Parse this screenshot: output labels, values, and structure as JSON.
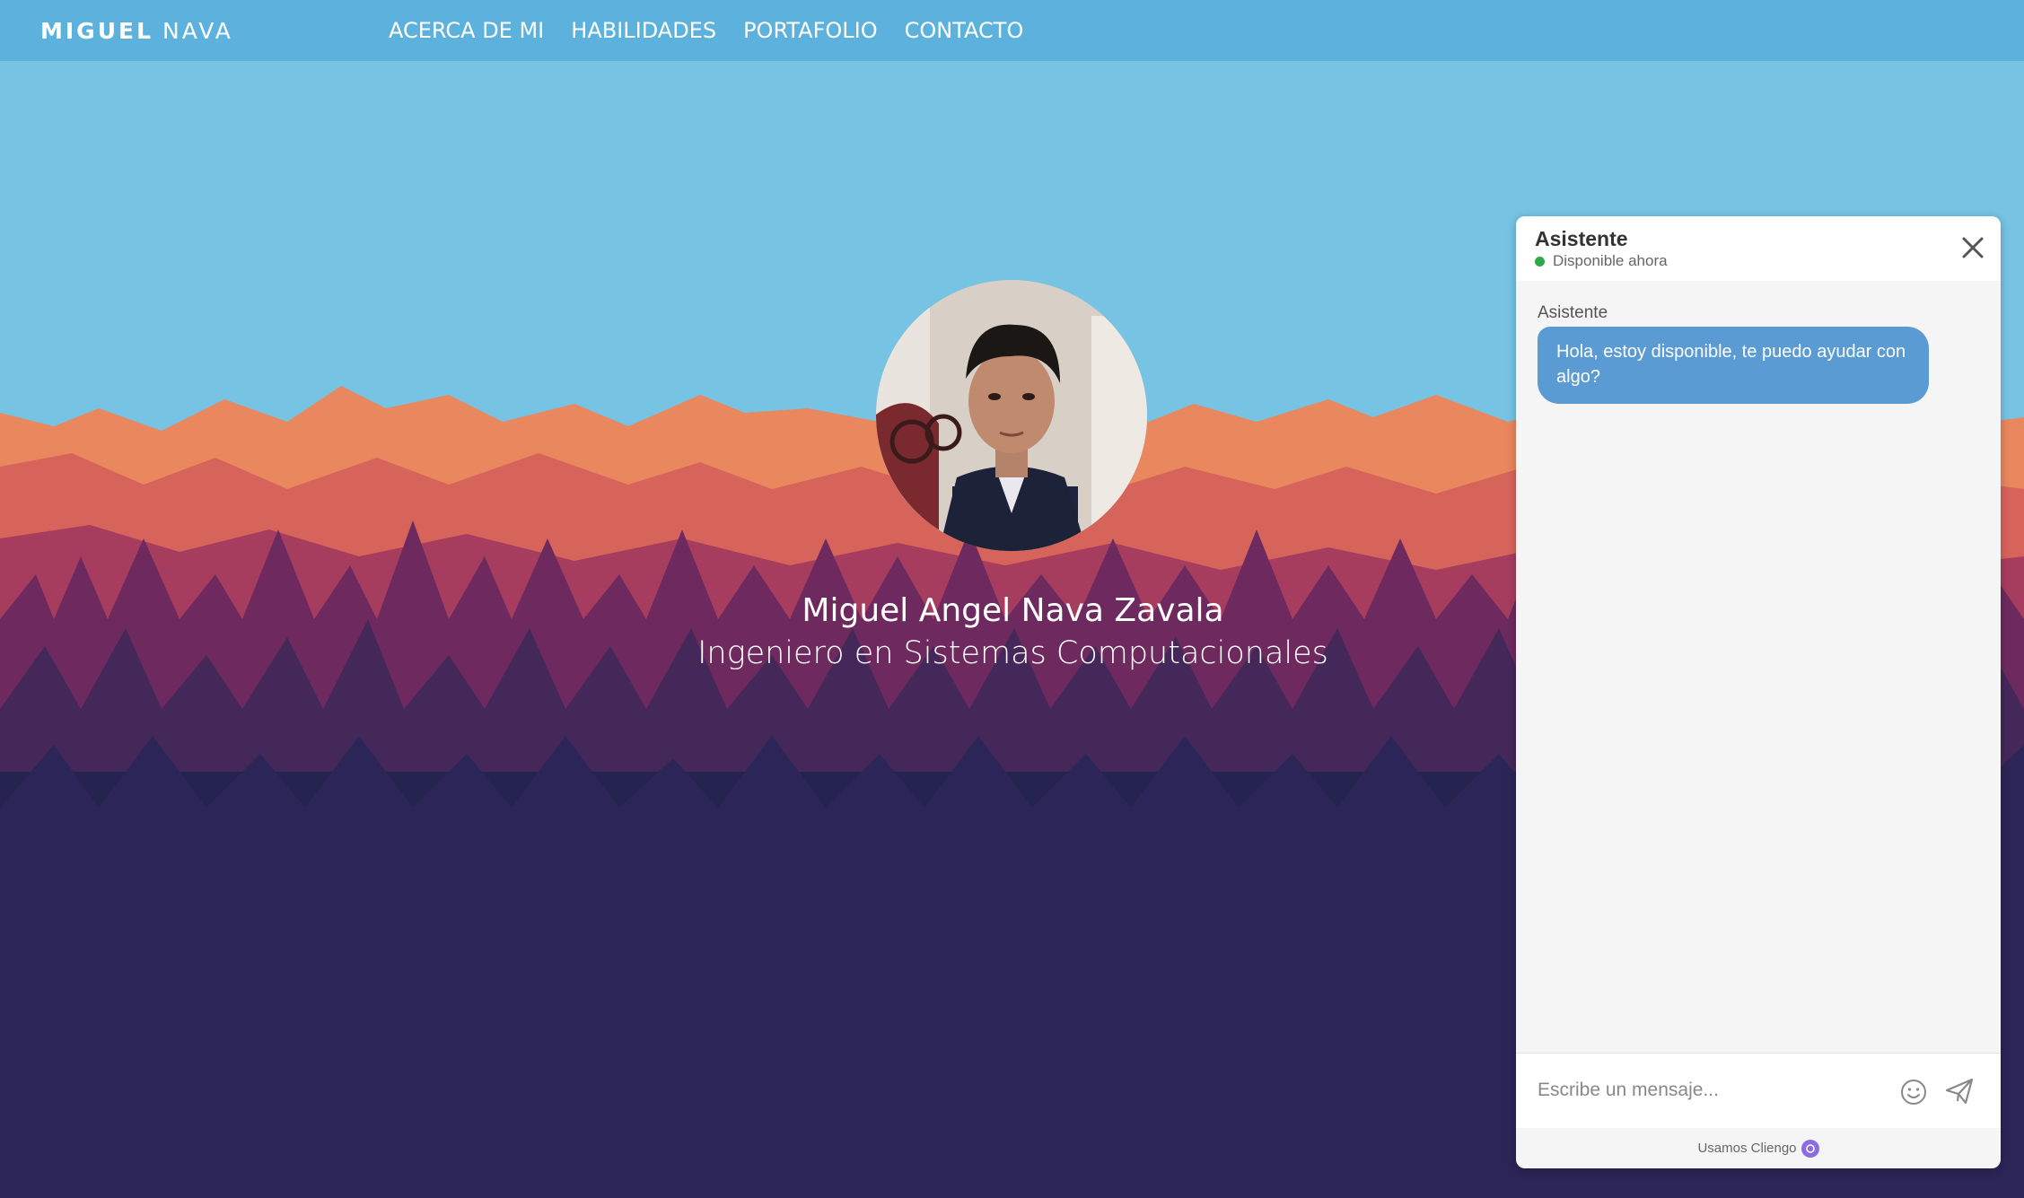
{
  "brand": {
    "first": "MIGUEL",
    "last": "NAVA"
  },
  "nav": {
    "items": [
      {
        "label": "ACERCA DE MI"
      },
      {
        "label": "HABILIDADES"
      },
      {
        "label": "PORTAFOLIO"
      },
      {
        "label": "CONTACTO"
      }
    ]
  },
  "hero": {
    "name": "Miguel Angel Nava Zavala",
    "title": "Ingeniero en Sistemas Computacionales"
  },
  "chat": {
    "title": "Asistente",
    "status": "Disponible ahora",
    "messages": [
      {
        "sender": "Asistente",
        "text": "Hola, estoy disponible, te puedo ayudar con algo?"
      }
    ],
    "input_placeholder": "Escribe un mensaje...",
    "footer": "Usamos Cliengo"
  },
  "colors": {
    "navbar": "#5cb1dd",
    "sky": "#76c3e3",
    "ground": "#25234f",
    "bubble": "#5a9bd3",
    "status_dot": "#2ea84a"
  }
}
